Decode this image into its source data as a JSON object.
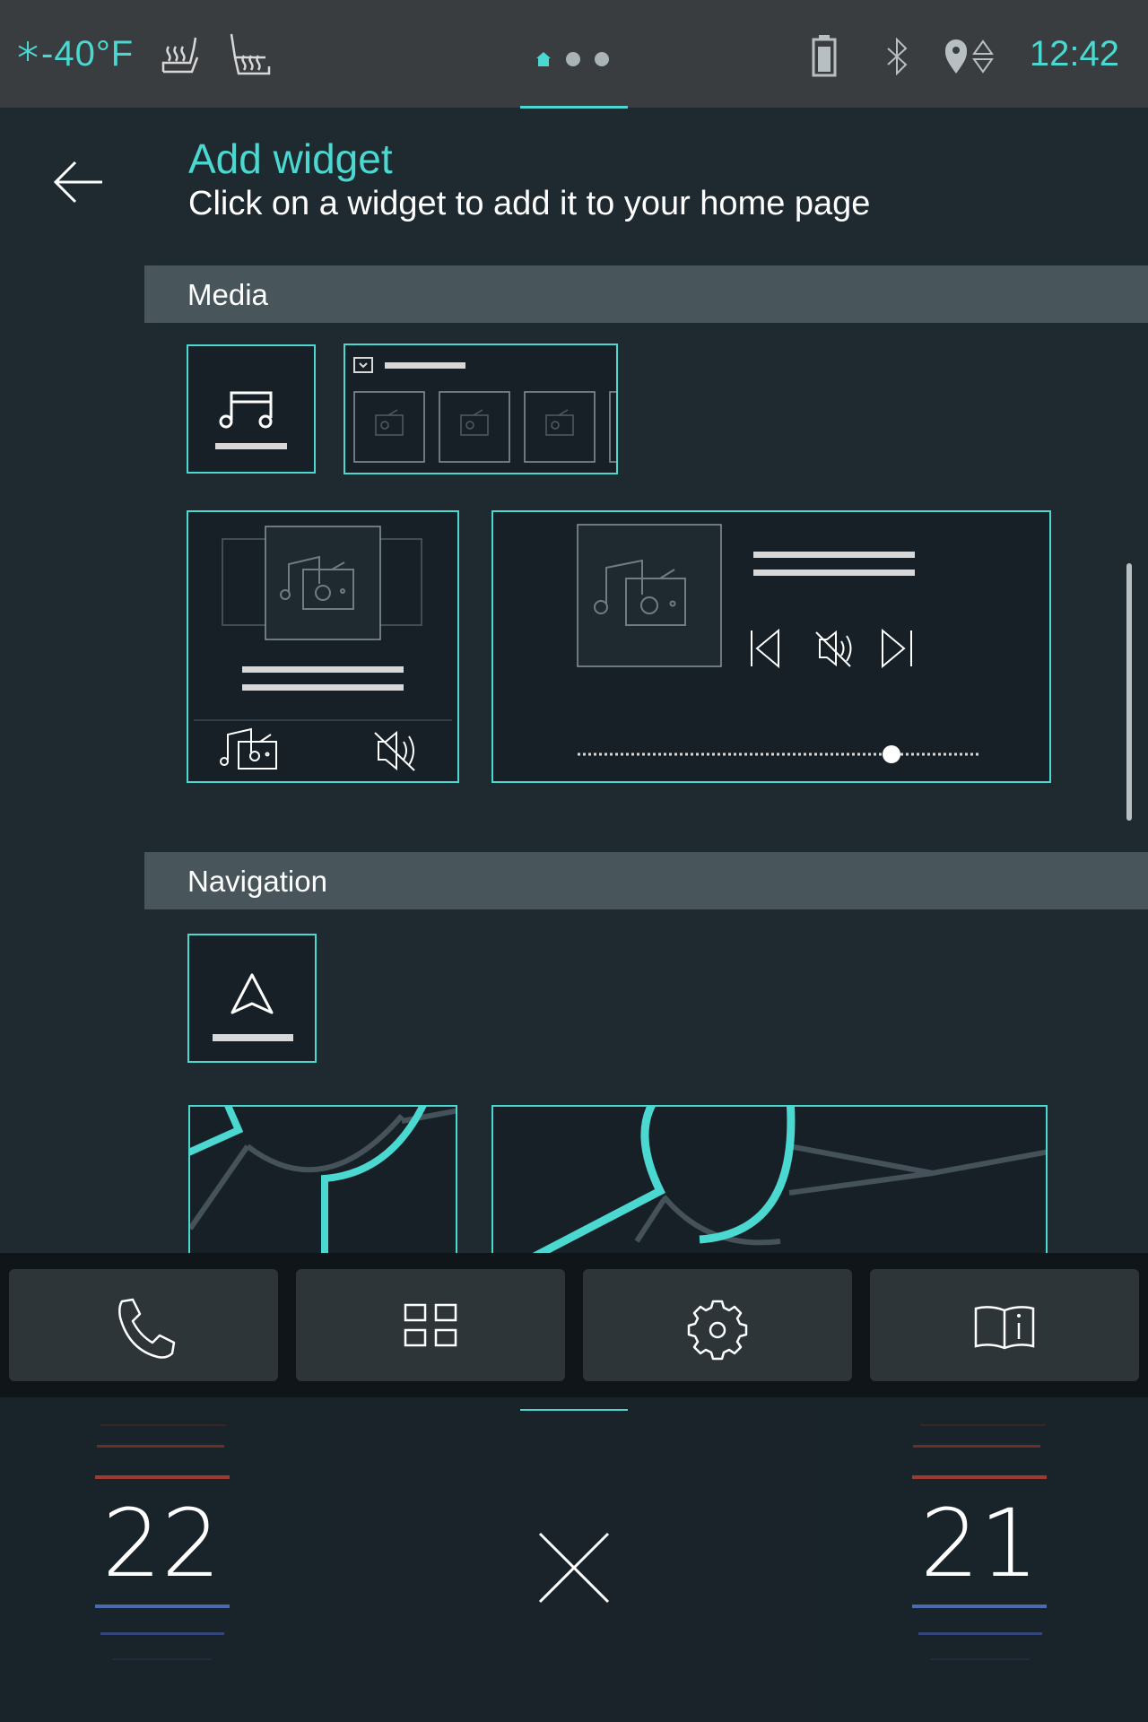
{
  "status_bar": {
    "outside_temperature": "-40°F",
    "clock": "12:42",
    "icons": [
      "snowflake-icon",
      "seat-heat-driver-icon",
      "seat-heat-passenger-icon",
      "home-icon",
      "page-dot-icon",
      "battery-icon",
      "bluetooth-icon",
      "location-icon"
    ]
  },
  "header": {
    "title": "Add widget",
    "subtitle": "Click on a widget to add it to your home page",
    "back_icon": "arrow-left-icon"
  },
  "sections": [
    {
      "title": "Media"
    },
    {
      "title": "Navigation"
    }
  ],
  "dock": {
    "buttons": [
      {
        "icon": "phone-icon"
      },
      {
        "icon": "apps-grid-icon"
      },
      {
        "icon": "settings-gear-icon"
      },
      {
        "icon": "manual-book-icon"
      }
    ]
  },
  "climate": {
    "left_temperature": "22",
    "right_temperature": "21",
    "close_icon": "close-icon"
  },
  "colors": {
    "accent": "#4ad8d0",
    "background": "#1e2a30",
    "section_header": "#48555b",
    "status_bar": "#3a3d3f"
  }
}
